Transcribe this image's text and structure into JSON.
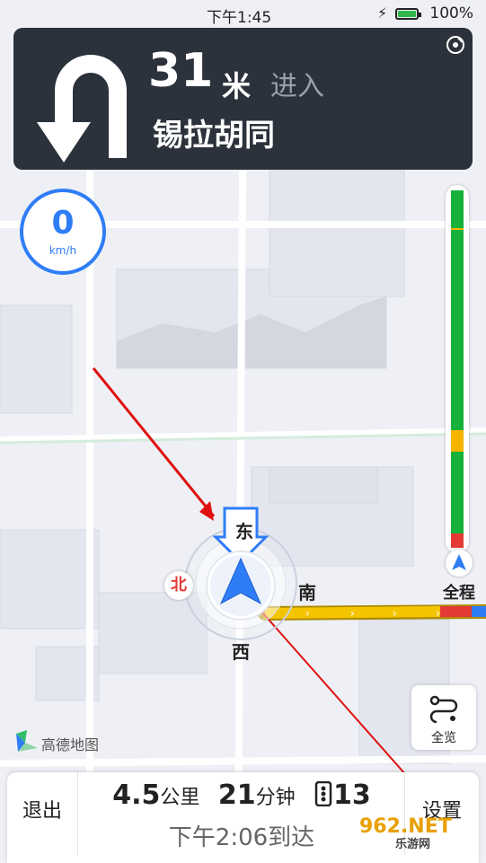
{
  "status_bar": {
    "time": "下午1:45",
    "battery_percent": "100%",
    "battery_level": 1.0
  },
  "guidance": {
    "distance": "31",
    "unit": "米",
    "action": "进入",
    "road_name": "锡拉胡同",
    "maneuver_icon": "u-turn-left-icon",
    "signal_icon": "gps-signal-icon"
  },
  "speedometer": {
    "value": "0",
    "unit": "km/h"
  },
  "route_progress": {
    "label": "全程",
    "traffic_segments": [
      {
        "status": "congested",
        "color": "#e53935",
        "from": 0.0,
        "to": 0.04
      },
      {
        "status": "smooth",
        "color": "#17b23b",
        "from": 0.04,
        "to": 0.27
      },
      {
        "status": "slow",
        "color": "#f5b400",
        "from": 0.27,
        "to": 0.33
      },
      {
        "status": "smooth",
        "color": "#17b23b",
        "from": 0.33,
        "to": 0.89
      },
      {
        "status": "slow",
        "color": "#f5b400",
        "from": 0.89,
        "to": 0.895
      },
      {
        "status": "smooth",
        "color": "#17b23b",
        "from": 0.895,
        "to": 1.0
      }
    ]
  },
  "compass": {
    "north": "北",
    "east": "东",
    "south": "南",
    "west": "西"
  },
  "overview_button": {
    "label": "全览",
    "icon": "route-overview-icon"
  },
  "map_logo": {
    "name": "高德地图"
  },
  "trip": {
    "exit_label": "退出",
    "settings_label": "设置",
    "distance_value": "4.5",
    "distance_unit": "公里",
    "time_value": "21",
    "time_unit": "分钟",
    "traffic_lights": "13",
    "traffic_light_icon": "traffic-light-icon",
    "eta": "下午2:06到达"
  },
  "watermark": {
    "text": "962.NET",
    "sub": "乐游网"
  },
  "colors": {
    "accent": "#2f7df6",
    "panel": "#2c323b",
    "route": "#f5c400"
  }
}
